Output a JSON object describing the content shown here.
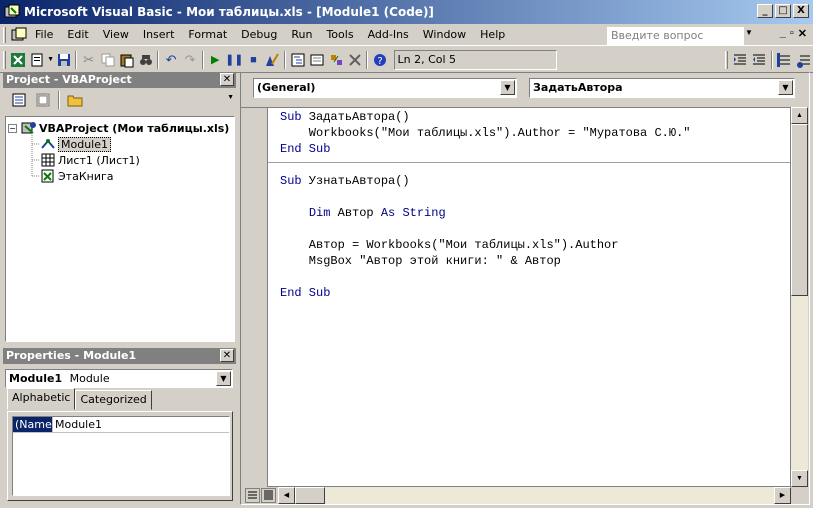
{
  "window": {
    "title": "Microsoft Visual Basic - Мои таблицы.xls - [Module1 (Code)]",
    "minimize": "_",
    "maximize": "□",
    "close": "X"
  },
  "menu": {
    "items": [
      "File",
      "Edit",
      "View",
      "Insert",
      "Format",
      "Debug",
      "Run",
      "Tools",
      "Add-Ins",
      "Window",
      "Help"
    ],
    "help_placeholder": "Введите вопрос"
  },
  "toolbar": {
    "cursor_position": "Ln 2, Col 5"
  },
  "project_panel": {
    "title": "Project - VBAProject",
    "tree": [
      {
        "label": "VBAProject (Мои таблицы.xls)",
        "level": 0,
        "bold": true
      },
      {
        "label": "Module1",
        "level": 1,
        "selected": true
      },
      {
        "label": "Лист1 (Лист1)",
        "level": 1
      },
      {
        "label": "ЭтаКнига",
        "level": 1
      }
    ]
  },
  "properties_panel": {
    "title": "Properties - Module1",
    "object_name": "Module1",
    "object_type": "Module",
    "tabs": [
      "Alphabetic",
      "Categorized"
    ],
    "active_tab": "Alphabetic",
    "rows": [
      {
        "name": "(Name)",
        "value": "Module1"
      }
    ]
  },
  "code_window": {
    "object_combo": "(General)",
    "procedure_combo": "ЗадатьАвтора",
    "lines": [
      "Sub ЗадатьАвтора()",
      "    Workbooks(\"Мои таблицы.xls\").Author = \"Муратова С.Ю.\"",
      "End Sub",
      "",
      "Sub УзнатьАвтора()",
      "",
      "    Dim Автор As String",
      "",
      "    Автор = Workbooks(\"Мои таблицы.xls\").Author",
      "    MsgBox \"Автор этой книги: \" & Автор",
      "",
      "End Sub"
    ]
  },
  "colors": {
    "title_bar_start": "#0a246a",
    "title_bar_end": "#a6caf0",
    "keyword": "#00008b",
    "face": "#d4d0c8"
  }
}
